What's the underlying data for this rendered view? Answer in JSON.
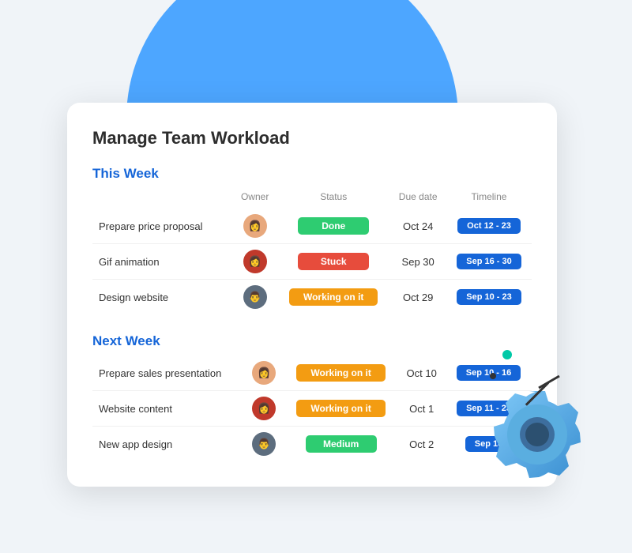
{
  "title": "Manage Team Workload",
  "sections": [
    {
      "label": "This Week",
      "columns": [
        "Owner",
        "Status",
        "Due date",
        "Timeline"
      ],
      "rows": [
        {
          "task": "Prepare price proposal",
          "owner_color": "#e8a87c",
          "owner_initials": "👩",
          "status": "Done",
          "status_class": "status-done",
          "due_date": "Oct 24",
          "timeline": "Oct 12 - 23"
        },
        {
          "task": "Gif animation",
          "owner_color": "#c0392b",
          "owner_initials": "👩",
          "status": "Stuck",
          "status_class": "status-stuck",
          "due_date": "Sep 30",
          "timeline": "Sep 16 - 30"
        },
        {
          "task": "Design website",
          "owner_color": "#5d6d7e",
          "owner_initials": "👨",
          "status": "Working on it",
          "status_class": "status-working",
          "due_date": "Oct 29",
          "timeline": "Sep 10 - 23"
        }
      ]
    },
    {
      "label": "Next Week",
      "rows": [
        {
          "task": "Prepare sales presentation",
          "owner_color": "#e8a87c",
          "owner_initials": "👩",
          "status": "Working on it",
          "status_class": "status-working",
          "due_date": "Oct 10",
          "timeline": "Sep 10 - 16"
        },
        {
          "task": "Website content",
          "owner_color": "#c0392b",
          "owner_initials": "👩",
          "status": "Working on it",
          "status_class": "status-working",
          "due_date": "Oct 1",
          "timeline": "Sep 11 - 23"
        },
        {
          "task": "New app design",
          "owner_color": "#5d6d7e",
          "owner_initials": "👨",
          "status": "Medium",
          "status_class": "status-medium",
          "due_date": "Oct 2",
          "timeline": "Sep 16"
        }
      ]
    }
  ]
}
